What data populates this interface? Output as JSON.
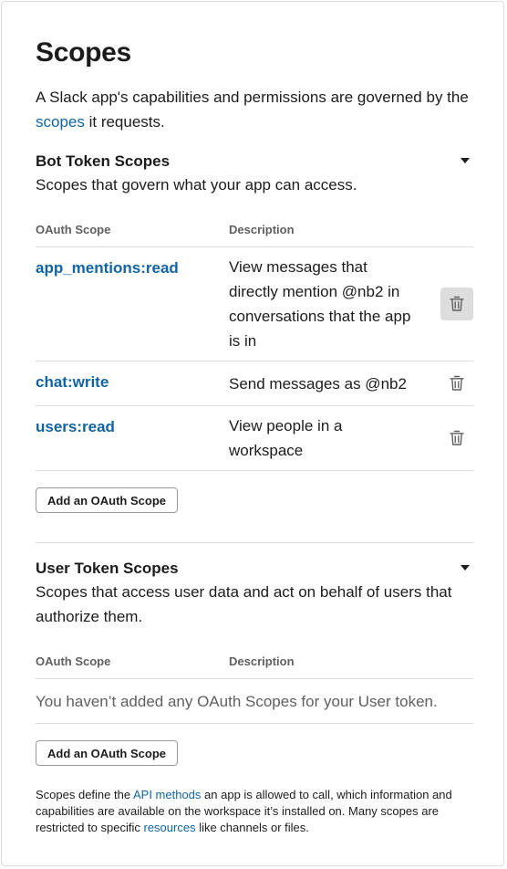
{
  "title": "Scopes",
  "intro": {
    "before": "A Slack app's capabilities and permissions are governed by the ",
    "link": "scopes",
    "after": " it requests."
  },
  "bot": {
    "title": "Bot Token Scopes",
    "subtitle": "Scopes that govern what your app can access.",
    "col_scope": "OAuth Scope",
    "col_desc": "Description",
    "scopes": [
      {
        "name": "app_mentions:read",
        "description": "View messages that directly mention @nb2 in conversations that the app is in"
      },
      {
        "name": "chat:write",
        "description": "Send messages as @nb2"
      },
      {
        "name": "users:read",
        "description": "View people in a workspace"
      }
    ],
    "add_button": "Add an OAuth Scope"
  },
  "user": {
    "title": "User Token Scopes",
    "subtitle": "Scopes that access user data and act on behalf of users that authorize them.",
    "col_scope": "OAuth Scope",
    "col_desc": "Description",
    "empty": "You haven’t added any OAuth Scopes for your User token.",
    "add_button": "Add an OAuth Scope"
  },
  "footnote": {
    "part1": "Scopes define the ",
    "link1": "API methods",
    "part2": " an app is allowed to call, which information and capabilities are available on the workspace it’s installed on. Many scopes are restricted to specific ",
    "link2": "resources",
    "part3": " like channels or files."
  },
  "icons": {
    "delete": "trash-icon",
    "collapse": "caret-down-icon"
  },
  "colors": {
    "link": "#1264a3",
    "text": "#1d1c1d",
    "muted": "#616061",
    "border": "#dddddd"
  }
}
